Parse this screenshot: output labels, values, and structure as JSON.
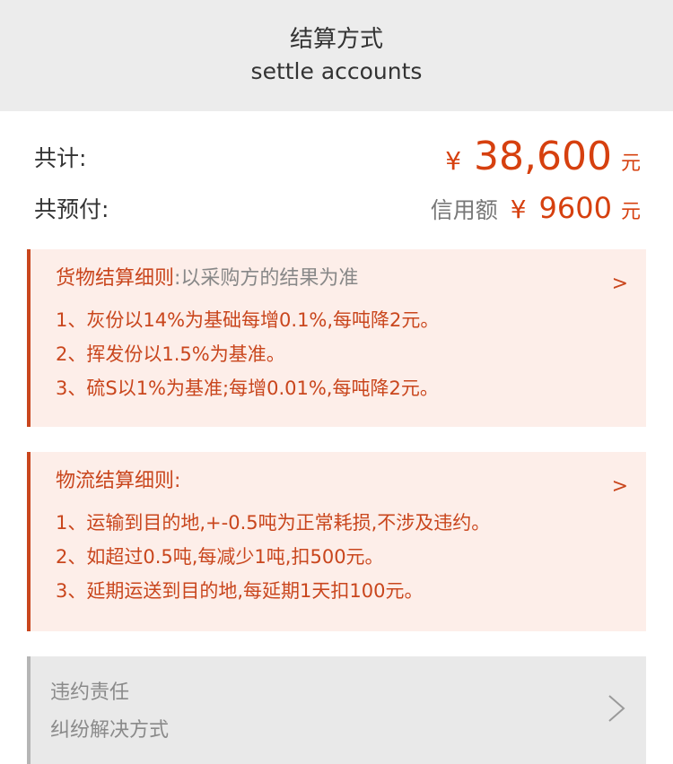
{
  "header": {
    "title_zh": "结算方式",
    "title_en": "settle accounts"
  },
  "totals": {
    "total_label": "共计:",
    "total_currency": "¥",
    "total_amount": "38,600",
    "total_unit": "元",
    "prepaid_label": "共预付:",
    "credit_label": "信用额",
    "prepaid_currency": "¥",
    "prepaid_amount": "9600",
    "prepaid_unit": "元"
  },
  "goods_rules": {
    "title": "货物结算细则",
    "title_suffix": ":以采购方的结果为准",
    "items": [
      "1、灰份以14%为基础每增0.1%,每吨降2元。",
      "2、挥发份以1.5%为基准。",
      "3、硫S以1%为基准;每增0.01%,每吨降2元。"
    ]
  },
  "logistics_rules": {
    "title": "物流结算细则:",
    "items": [
      "1、运输到目的地,+-0.5吨为正常耗损,不涉及违约。",
      "2、如超过0.5吨,每减少1吨,扣500元。",
      "3、延期运送到目的地,每延期1天扣100元。"
    ]
  },
  "footer": {
    "items": [
      "违约责任",
      "纠纷解决方式"
    ]
  },
  "colors": {
    "accent": "#c9461d",
    "price": "#d6400f",
    "card_bg": "#fdeee9",
    "header_bg": "#ececec"
  },
  "icons": {
    "card_arrow": "chevron-right-icon",
    "footer_arrow": "chevron-right-icon"
  }
}
